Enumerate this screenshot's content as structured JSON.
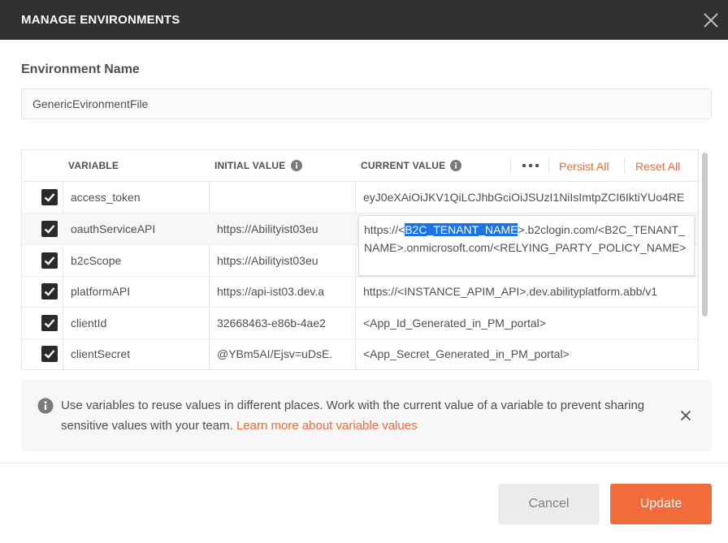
{
  "dialog": {
    "title": "MANAGE ENVIRONMENTS",
    "close_icon": "close-icon"
  },
  "environment": {
    "name_label": "Environment Name",
    "name_value": "GenericEvironmentFile"
  },
  "table": {
    "headers": {
      "variable": "VARIABLE",
      "initial_value": "INITIAL VALUE",
      "current_value": "CURRENT VALUE"
    },
    "actions": {
      "persist_all": "Persist All",
      "reset_all": "Reset All",
      "more_icon": "ellipsis-icon"
    },
    "rows": [
      {
        "checked": true,
        "variable": "access_token",
        "initial_value": "",
        "current_value": "eyJ0eXAiOiJKV1QiLCJhbGciOiJSUzI1NiIsImtpZCI6IktiYUo4RE"
      },
      {
        "checked": true,
        "variable": "oauthServiceAPI",
        "initial_value": "https://Abilityist03eu",
        "current_value": ""
      },
      {
        "checked": true,
        "variable": "b2cScope",
        "initial_value": "https://Abilityist03eu",
        "current_value": ""
      },
      {
        "checked": true,
        "variable": "platformAPI",
        "initial_value": "https://api-ist03.dev.a",
        "current_value": "https://<INSTANCE_APIM_API>.dev.abilityplatform.abb/v1"
      },
      {
        "checked": true,
        "variable": "clientId",
        "initial_value": "32668463-e86b-4ae2",
        "current_value": "<App_Id_Generated_in_PM_portal>"
      },
      {
        "checked": true,
        "variable": "clientSecret",
        "initial_value": "@YBm5AI/Ejsv=uDsE.",
        "current_value": "<App_Secret_Generated_in_PM_portal>"
      }
    ],
    "editing": {
      "prefix": "https://<",
      "selected": "B2C_TENANT_NAME",
      "suffix": ">.b2clogin.com/<B2C_TENANT_NAME>.onmicrosoft.com/<RELYING_PARTY_POLICY_NAME>"
    }
  },
  "info": {
    "text": "Use variables to reuse values in different places. Work with the current value of a variable to prevent sharing sensitive values with your team.",
    "link": "Learn more about variable values"
  },
  "footer": {
    "cancel_label": "Cancel",
    "update_label": "Update"
  },
  "colors": {
    "accent": "#f26b3a",
    "titlebar": "#303030",
    "selection": "#1a73e8"
  }
}
